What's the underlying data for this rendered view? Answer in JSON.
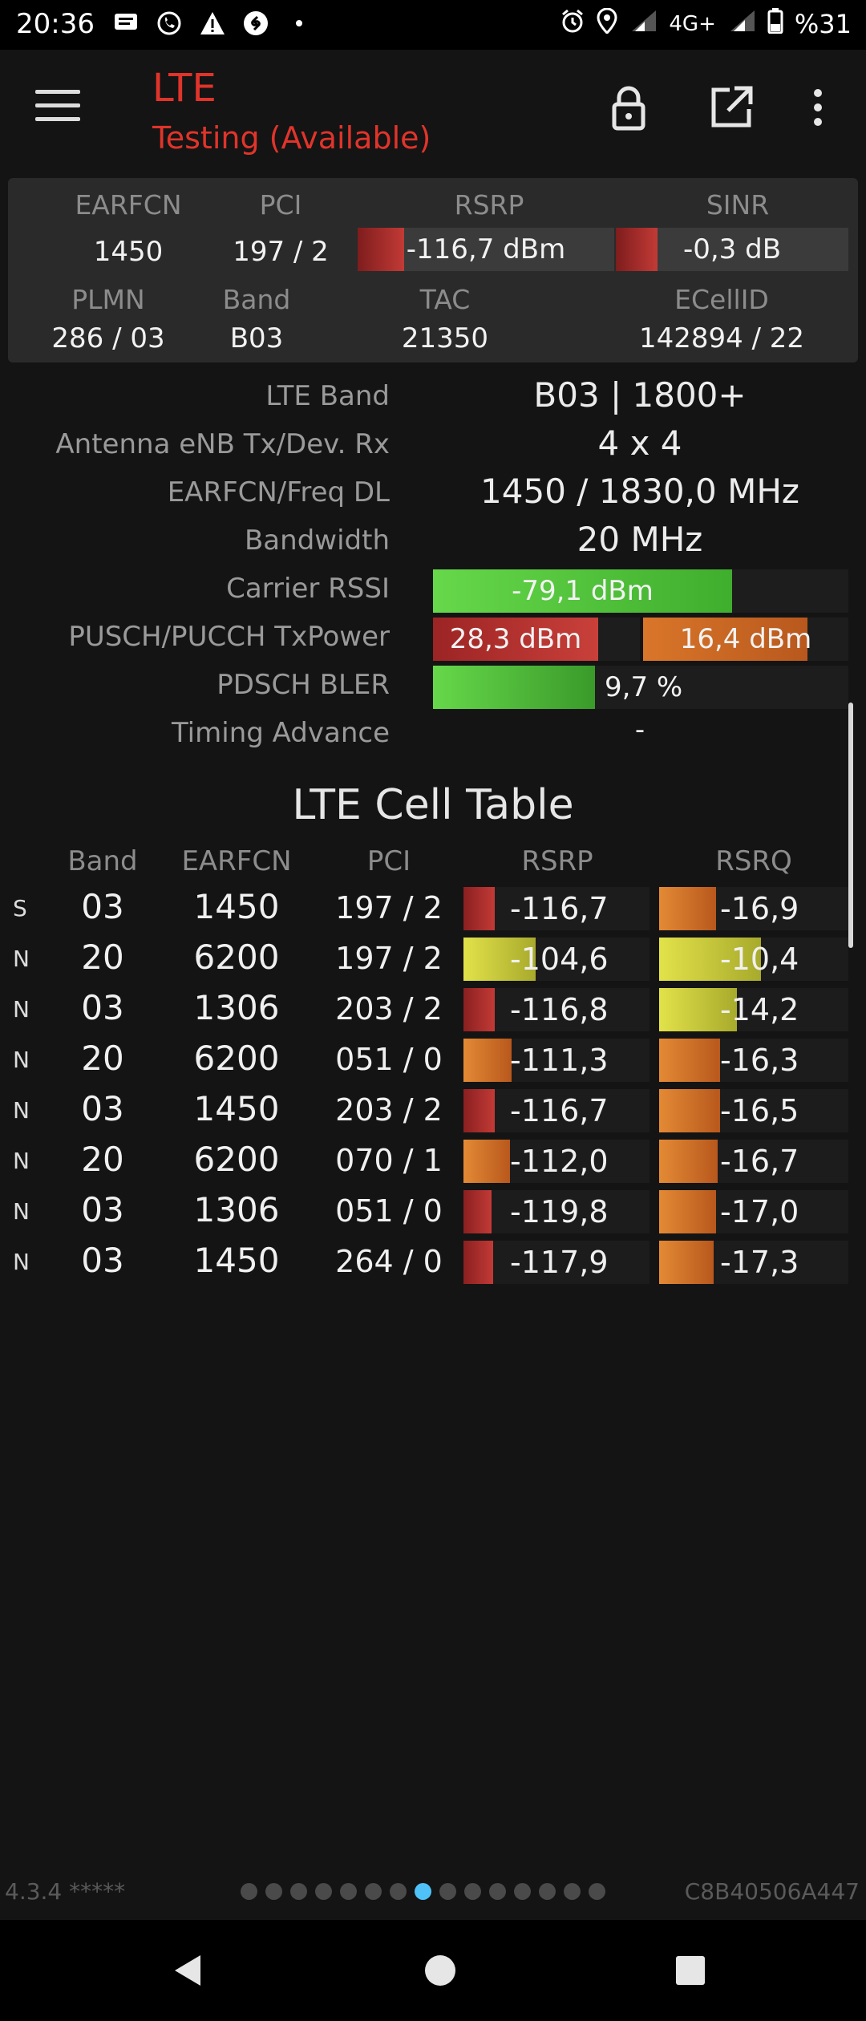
{
  "status_bar": {
    "time": "20:36",
    "network": "4G+",
    "battery": "%31",
    "icons": [
      "message-icon",
      "whatsapp-icon",
      "warning-icon",
      "shazam-icon",
      "dot-icon",
      "alarm-icon",
      "location-icon",
      "signal-icon",
      "signal-icon-2",
      "battery-icon"
    ]
  },
  "app_bar": {
    "title": "LTE",
    "subtitle": "Testing (Available)",
    "accent": "#e0342b"
  },
  "summary": {
    "labels": {
      "earfcn": "EARFCN",
      "pci": "PCI",
      "rsrp": "RSRP",
      "sinr": "SINR",
      "plmn": "PLMN",
      "band": "Band",
      "tac": "TAC",
      "ecellid": "ECellID"
    },
    "values": {
      "earfcn": "1450",
      "pci": "197 / 2",
      "rsrp": "-116,7 dBm",
      "rsrp_level": 0.18,
      "sinr": "-0,3 dB",
      "sinr_level": 0.18,
      "plmn": "286 / 03",
      "band": "B03",
      "tac": "21350",
      "ecellid": "142894 / 22"
    }
  },
  "details": {
    "lte_band": {
      "label": "LTE Band",
      "value": "B03 | 1800+"
    },
    "antenna": {
      "label": "Antenna eNB Tx/Dev. Rx",
      "value": "4 x 4"
    },
    "freq": {
      "label": "EARFCN/Freq DL",
      "value": "1450 / 1830,0 MHz"
    },
    "bandwidth": {
      "label": "Bandwidth",
      "value": "20 MHz"
    },
    "rssi": {
      "label": "Carrier RSSI",
      "value": "-79,1 dBm",
      "level": 0.72
    },
    "txpower": {
      "label": "PUSCH/PUCCH TxPower",
      "pusch": "28,3 dBm",
      "pusch_level": 0.8,
      "pucch": "16,4 dBm",
      "pucch_level": 0.8
    },
    "bler": {
      "label": "PDSCH BLER",
      "value": "9,7 %",
      "level": 0.39
    },
    "timing": {
      "label": "Timing Advance",
      "value": "-"
    }
  },
  "cell_table": {
    "title": "LTE Cell Table",
    "headers": {
      "band": "Band",
      "earfcn": "EARFCN",
      "pci": "PCI",
      "rsrp": "RSRP",
      "rsrq": "RSRQ"
    },
    "rows": [
      {
        "type": "S",
        "band": "03",
        "earfcn": "1450",
        "pci": "197 / 2",
        "rsrp": "-116,7",
        "rsrp_level": 0.17,
        "rsrp_color": "red",
        "rsrq": "-16,9",
        "rsrq_level": 0.3,
        "rsrq_color": "orange"
      },
      {
        "type": "N",
        "band": "20",
        "earfcn": "6200",
        "pci": "197 / 2",
        "rsrp": "-104,6",
        "rsrp_level": 0.39,
        "rsrp_color": "yellow",
        "rsrq": "-10,4",
        "rsrq_level": 0.54,
        "rsrq_color": "yellow"
      },
      {
        "type": "N",
        "band": "03",
        "earfcn": "1306",
        "pci": "203 / 2",
        "rsrp": "-116,8",
        "rsrp_level": 0.17,
        "rsrp_color": "red",
        "rsrq": "-14,2",
        "rsrq_level": 0.41,
        "rsrq_color": "yellow"
      },
      {
        "type": "N",
        "band": "20",
        "earfcn": "6200",
        "pci": "051 / 0",
        "rsrp": "-111,3",
        "rsrp_level": 0.26,
        "rsrp_color": "orange",
        "rsrq": "-16,3",
        "rsrq_level": 0.32,
        "rsrq_color": "orange"
      },
      {
        "type": "N",
        "band": "03",
        "earfcn": "1450",
        "pci": "203 / 2",
        "rsrp": "-116,7",
        "rsrp_level": 0.17,
        "rsrp_color": "red",
        "rsrq": "-16,5",
        "rsrq_level": 0.32,
        "rsrq_color": "orange"
      },
      {
        "type": "N",
        "band": "20",
        "earfcn": "6200",
        "pci": "070 / 1",
        "rsrp": "-112,0",
        "rsrp_level": 0.25,
        "rsrp_color": "orange",
        "rsrq": "-16,7",
        "rsrq_level": 0.31,
        "rsrq_color": "orange"
      },
      {
        "type": "N",
        "band": "03",
        "earfcn": "1306",
        "pci": "051 / 0",
        "rsrp": "-119,8",
        "rsrp_level": 0.15,
        "rsrp_color": "red",
        "rsrq": "-17,0",
        "rsrq_level": 0.3,
        "rsrq_color": "orange"
      },
      {
        "type": "N",
        "band": "03",
        "earfcn": "1450",
        "pci": "264 / 0",
        "rsrp": "-117,9",
        "rsrp_level": 0.16,
        "rsrp_color": "red",
        "rsrq": "-17,3",
        "rsrq_level": 0.29,
        "rsrq_color": "orange"
      }
    ]
  },
  "footer": {
    "version": "4.3.4 *****",
    "device_id": "C8B40506A447",
    "page_count": 15,
    "active_page": 8
  },
  "colors": {
    "red": "#b02e2c",
    "orange": "#d9762a",
    "yellow": "#c8c93a",
    "green": "#55c43c",
    "active_dot": "#4fc3f7"
  }
}
